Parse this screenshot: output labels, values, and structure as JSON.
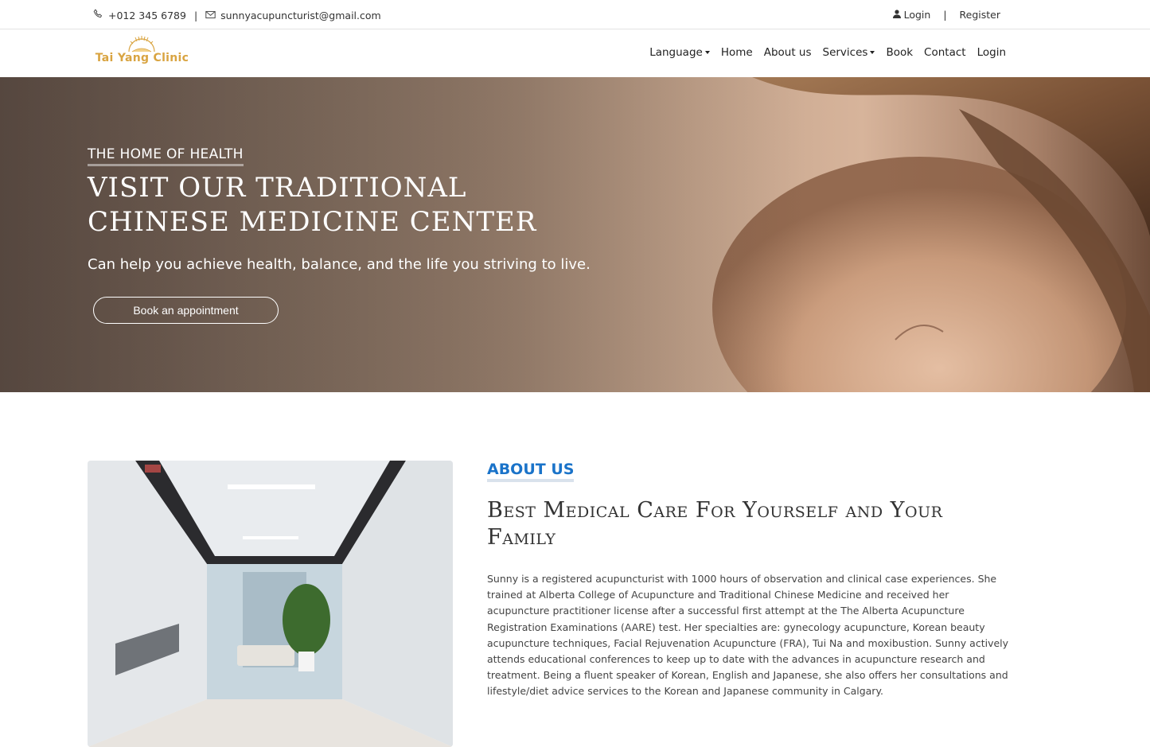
{
  "topbar": {
    "phone": "+012 345 6789",
    "email": "sunnyacupuncturist@gmail.com",
    "login": "Login",
    "register": "Register"
  },
  "brand": {
    "name": "Tai Yang Clinic",
    "color": "#d9a441"
  },
  "nav": {
    "language": "Language",
    "home": "Home",
    "about": "About us",
    "services": "Services",
    "book": "Book",
    "contact": "Contact",
    "login": "Login"
  },
  "hero": {
    "eyebrow": "THE HOME OF HEALTH",
    "title_line1": "VISIT OUR TRADITIONAL",
    "title_line2": "CHINESE MEDICINE CENTER",
    "subtitle": "Can help you achieve health, balance, and the life you striving to live.",
    "cta": "Book an appointment"
  },
  "about": {
    "label": "ABOUT US",
    "title": "Best Medical Care For Yourself and Your Family",
    "text": "Sunny is a registered acupuncturist with 1000 hours of observation and clinical case experiences. She trained at Alberta College of Acupuncture and Traditional Chinese Medicine and received her acupuncture practitioner license after a successful first attempt at the The Alberta Acupuncture Registration Examinations (AARE) test. Her specialties are: gynecology acupuncture, Korean beauty acupuncture techniques, Facial Rejuvenation Acupuncture (FRA), Tui Na and moxibustion. Sunny actively attends educational conferences to keep up to date with the advances in acupuncture research and treatment. Being a fluent speaker of Korean, English and Japanese, she also offers her consultations and lifestyle/diet advice services to the Korean and Japanese community in Calgary.",
    "accent_color": "#1a73c9"
  }
}
